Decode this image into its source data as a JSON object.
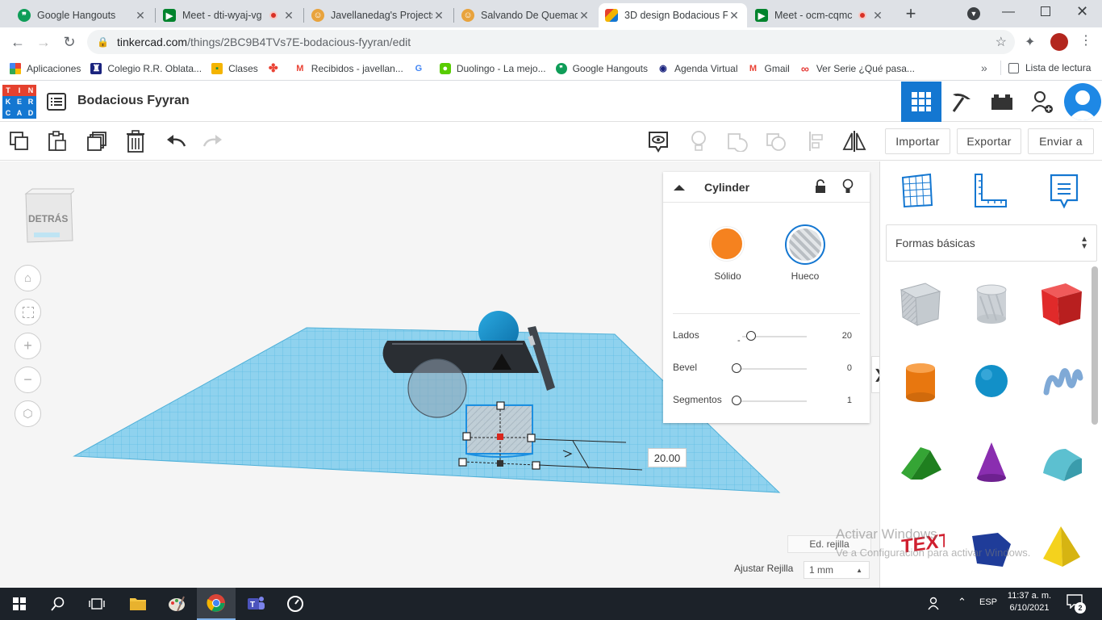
{
  "browser": {
    "tabs": [
      {
        "title": "Google Hangouts",
        "icon": "hangouts-icon",
        "color": "#0f9d58"
      },
      {
        "title": "Meet - dti-wyaj-vg",
        "icon": "meet-icon",
        "color": "#00832d",
        "recording": true
      },
      {
        "title": "Javellanedag's Projects",
        "icon": "tinkercad-avatar-icon",
        "color": "#e8a33d"
      },
      {
        "title": "Salvando De Quemadu",
        "icon": "tinkercad-avatar-icon",
        "color": "#e8a33d"
      },
      {
        "title": "3D design Bodacious F",
        "icon": "tinkercad-icon",
        "color": "#1477d1",
        "active": true
      },
      {
        "title": "Meet - ocm-cqmc",
        "icon": "meet-icon",
        "color": "#00832d",
        "recording": true
      }
    ],
    "new_tab": "+",
    "url_host": "tinkercad.com",
    "url_path": "/things/2BC9B4TVs7E-bodacious-fyyran/edit",
    "bookmarks": [
      {
        "label": "Aplicaciones",
        "icon": "apps-grid-icon",
        "color": "#4285f4"
      },
      {
        "label": "Colegio R.R. Oblata...",
        "icon": "school-shield-icon",
        "color": "#1a237e"
      },
      {
        "label": "Clases",
        "icon": "classroom-icon",
        "color": "#f4b400"
      },
      {
        "label": "",
        "icon": "google-photos-icon",
        "color": "#ea4335"
      },
      {
        "label": "Recibidos - javellan...",
        "icon": "gmail-icon",
        "color": "#ea4335"
      },
      {
        "label": "",
        "icon": "google-g-icon",
        "color": "#4285f4"
      },
      {
        "label": "Duolingo - La mejo...",
        "icon": "duolingo-icon",
        "color": "#58cc02"
      },
      {
        "label": "Google Hangouts",
        "icon": "hangouts-icon",
        "color": "#0f9d58"
      },
      {
        "label": "Agenda Virtual",
        "icon": "agenda-icon",
        "color": "#1a237e"
      },
      {
        "label": "Gmail",
        "icon": "gmail-icon",
        "color": "#ea4335"
      },
      {
        "label": "Ver Serie ¿Qué pasa...",
        "icon": "infinity-icon",
        "color": "#e53935"
      }
    ],
    "bookmarks_more": "»",
    "reading_list": "Lista de lectura"
  },
  "app": {
    "logo_letters": [
      "T",
      "I",
      "N",
      "K",
      "E",
      "R",
      "C",
      "A",
      "D"
    ],
    "logo_colors": [
      "#e5412e",
      "#e5412e",
      "#e5412e",
      "#1477d1",
      "#1477d1",
      "#1477d1",
      "#1477d1",
      "#1477d1",
      "#1477d1"
    ],
    "design_title": "Bodacious Fyyran",
    "accent": "#1477d1"
  },
  "toolbar": {
    "import_label": "Importar",
    "export_label": "Exportar",
    "send_label": "Enviar a"
  },
  "viewcube": {
    "label": "DETRÁS"
  },
  "inspector": {
    "title": "Cylinder",
    "solid_label": "Sólido",
    "hole_label": "Hueco",
    "solid_color": "#f5821f",
    "params": [
      {
        "label": "Lados",
        "value": "20",
        "fraction": 0.2
      },
      {
        "label": "Bevel",
        "value": "0",
        "fraction": 0.0
      },
      {
        "label": "Segmentos",
        "value": "1",
        "fraction": 0.0
      }
    ]
  },
  "workplane": {
    "dimension_value": "20.00",
    "edit_grid_label": "Ed. rejilla",
    "snap_grid_label": "Ajustar Rejilla",
    "snap_grid_value": "1 mm",
    "watermark_line1": "Activar Windows",
    "watermark_line2": "Ve a Configuración para activar Windows."
  },
  "shapes_panel": {
    "category": "Formas básicas",
    "collapse_arrow": "❯",
    "shapes": [
      {
        "name": "box-hole",
        "icon": "box-hole-icon"
      },
      {
        "name": "cylinder-hole",
        "icon": "cylinder-hole-icon"
      },
      {
        "name": "box",
        "icon": "box-icon",
        "color": "#e02a2a"
      },
      {
        "name": "cylinder",
        "icon": "cylinder-icon",
        "color": "#f5821f"
      },
      {
        "name": "sphere",
        "icon": "sphere-icon",
        "color": "#1290c8"
      },
      {
        "name": "scribble",
        "icon": "scribble-icon",
        "color": "#7fa9d6"
      },
      {
        "name": "roof",
        "icon": "roof-icon",
        "color": "#35a535"
      },
      {
        "name": "cone",
        "icon": "cone-icon",
        "color": "#8a2eb0"
      },
      {
        "name": "round-roof",
        "icon": "round-roof-icon",
        "color": "#5cc0d0"
      },
      {
        "name": "text",
        "icon": "text-shape-icon",
        "color": "#d01f2f"
      },
      {
        "name": "polygon",
        "icon": "polygon-icon",
        "color": "#1f3c99"
      },
      {
        "name": "pyramid",
        "icon": "pyramid-icon",
        "color": "#f4d21d"
      }
    ]
  },
  "taskbar": {
    "lang": "ESP",
    "time": "11:37 a. m.",
    "date": "6/10/2021",
    "notifications": "2"
  }
}
